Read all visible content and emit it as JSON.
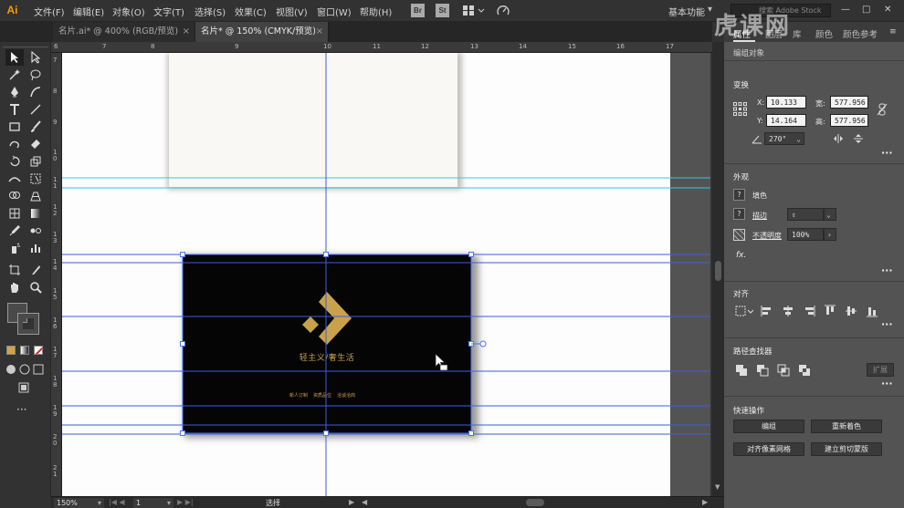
{
  "app": {
    "logo": "Ai",
    "workspace": "基本功能",
    "stock_placeholder": "搜索 Adobe Stock",
    "bridge_icon": "Br",
    "stock_icon": "St"
  },
  "menu": [
    "文件(F)",
    "编辑(E)",
    "对象(O)",
    "文字(T)",
    "选择(S)",
    "效果(C)",
    "视图(V)",
    "窗口(W)",
    "帮助(H)"
  ],
  "tabs": [
    {
      "label": "名片.ai* @ 400% (RGB/预览)",
      "close": "×"
    },
    {
      "label": "名片* @ 150% (CMYK/预览)",
      "close": "×"
    }
  ],
  "ruler": {
    "h_labels": [
      "6",
      "7",
      "8",
      "9",
      "10",
      "11",
      "12",
      "13",
      "14",
      "15",
      "16",
      "17"
    ],
    "v_labels": [
      "7",
      "8",
      "9",
      "1 0",
      "1 1",
      "1 2",
      "1 3",
      "1 4",
      "1 5",
      "1 6",
      "1 7",
      "1 8",
      "1 9",
      "2 0",
      "2 1"
    ]
  },
  "card": {
    "slogan": "轻主义/奢生活",
    "info": [
      "新人订制",
      "资质品位",
      "洽谈洽商"
    ]
  },
  "status": {
    "zoom": "150%",
    "page": "1",
    "tool": "选择"
  },
  "panel": {
    "tabs": [
      "属性",
      "图层",
      "库",
      "颜色",
      "颜色参考"
    ],
    "object_type": "编组对象",
    "transform": {
      "title": "变换",
      "x_label": "X:",
      "x_value": "10.133 c",
      "y_label": "Y:",
      "y_value": "14.164 c",
      "w_label": "宽:",
      "w_value": "577.956",
      "h_label": "高:",
      "h_value": "577.956",
      "angle_value": "270°"
    },
    "appearance": {
      "title": "外观",
      "fill": "填色",
      "stroke": "描边",
      "opacity": "不透明度",
      "opacity_value": "100%",
      "fx": "fx."
    },
    "align": {
      "title": "对齐"
    },
    "pathfinder": {
      "title": "路径查找器",
      "expand": "扩展"
    },
    "quick_actions": {
      "title": "快速操作",
      "group": "编组",
      "recolor": "重新着色",
      "align_pixel": "对齐像素网格",
      "crop_marks": "建立剪切蒙版"
    }
  },
  "watermark": "虎课网",
  "colors": {
    "accent": "#c8a24a",
    "ui_bg": "#323232",
    "panel_bg": "#535353",
    "guide_cyan": "#35c9e0",
    "guide_blue": "#3c5fd8"
  }
}
